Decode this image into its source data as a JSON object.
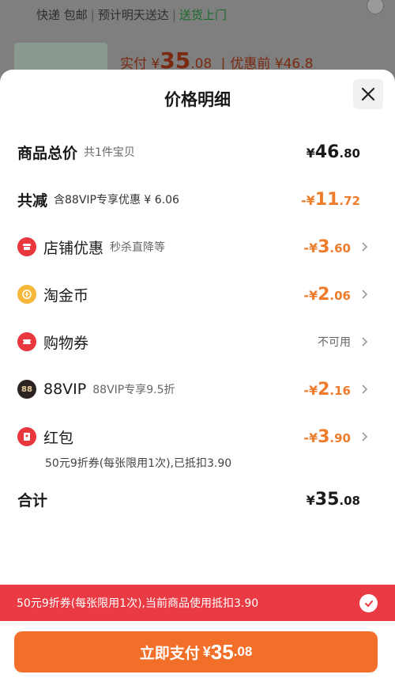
{
  "background": {
    "shipping": [
      "快递 包邮",
      "预计明天送达",
      "送货上门"
    ],
    "price_label": "实付",
    "price_currency": "¥",
    "price_int": "35",
    "price_dec": ".08",
    "price_before": "优惠前 ¥46.8"
  },
  "sheet": {
    "title": "价格明细",
    "close_icon": "close-icon"
  },
  "rows": {
    "total": {
      "label": "商品总价",
      "sub": "共1件宝贝",
      "cur": "¥",
      "int": "46",
      "dec": ".80"
    },
    "reduce": {
      "label": "共减",
      "sub": "含88VIP专享优惠 ¥ 6.06",
      "cur": "-¥",
      "int": "11",
      "dec": ".72"
    },
    "shop": {
      "label": "店铺优惠",
      "sub": "秒杀直降等",
      "cur": "-¥",
      "int": "3",
      "dec": ".60",
      "icon": "shop-icon"
    },
    "coin": {
      "label": "淘金币",
      "cur": "-¥",
      "int": "2",
      "dec": ".06",
      "icon": "coin-icon"
    },
    "voucher": {
      "label": "购物券",
      "value": "不可用",
      "icon": "ticket-icon"
    },
    "vip": {
      "label": "88VIP",
      "sub": "88VIP专享9.5折",
      "cur": "-¥",
      "int": "2",
      "dec": ".16",
      "badge": "88"
    },
    "redpacket": {
      "label": "红包",
      "cur": "-¥",
      "int": "3",
      "dec": ".90",
      "note": "50元9折券(每张限用1次),已抵扣3.90",
      "icon": "red-packet-icon"
    },
    "sum": {
      "label": "合计",
      "cur": "¥",
      "int": "35",
      "dec": ".08"
    }
  },
  "coupon_banner": {
    "text": "50元9折券(每张限用1次),当前商品使用抵扣3.90"
  },
  "pay": {
    "label": "立即支付",
    "cur": "¥",
    "int": "35",
    "dec": ".08"
  },
  "colors": {
    "accent_orange": "#f26f2a",
    "discount_orange": "#ef7c2b",
    "banner_red": "#ea3a43"
  }
}
